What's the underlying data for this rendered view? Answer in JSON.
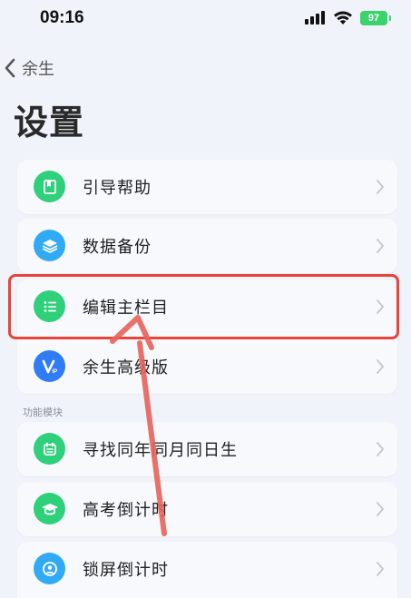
{
  "status_bar": {
    "time": "09:16",
    "battery": "97"
  },
  "nav": {
    "back_label": "余生"
  },
  "page": {
    "title": "设置"
  },
  "rows": [
    {
      "label": "引导帮助",
      "icon": "book-icon",
      "color": "#2fd07a"
    },
    {
      "label": "数据备份",
      "icon": "layers-icon",
      "color": "#31aaf5"
    },
    {
      "label": "编辑主栏目",
      "icon": "list-icon",
      "color": "#2fd07a"
    },
    {
      "label": "余生高级版",
      "icon": "vip-icon",
      "color": "#2f7cf5"
    }
  ],
  "section": {
    "label": "功能模块"
  },
  "feature_rows": [
    {
      "label": "寻找同年同月同日生",
      "icon": "calendar-icon",
      "color": "#2fd07a"
    },
    {
      "label": "高考倒计时",
      "icon": "graduation-cap-icon",
      "color": "#2fd07a"
    },
    {
      "label": "锁屏倒计时",
      "icon": "lock-screen-icon",
      "color": "#31aaf5"
    }
  ],
  "annotation": {
    "highlight_color": "#e8443a",
    "arrow_color": "#e8615a"
  }
}
